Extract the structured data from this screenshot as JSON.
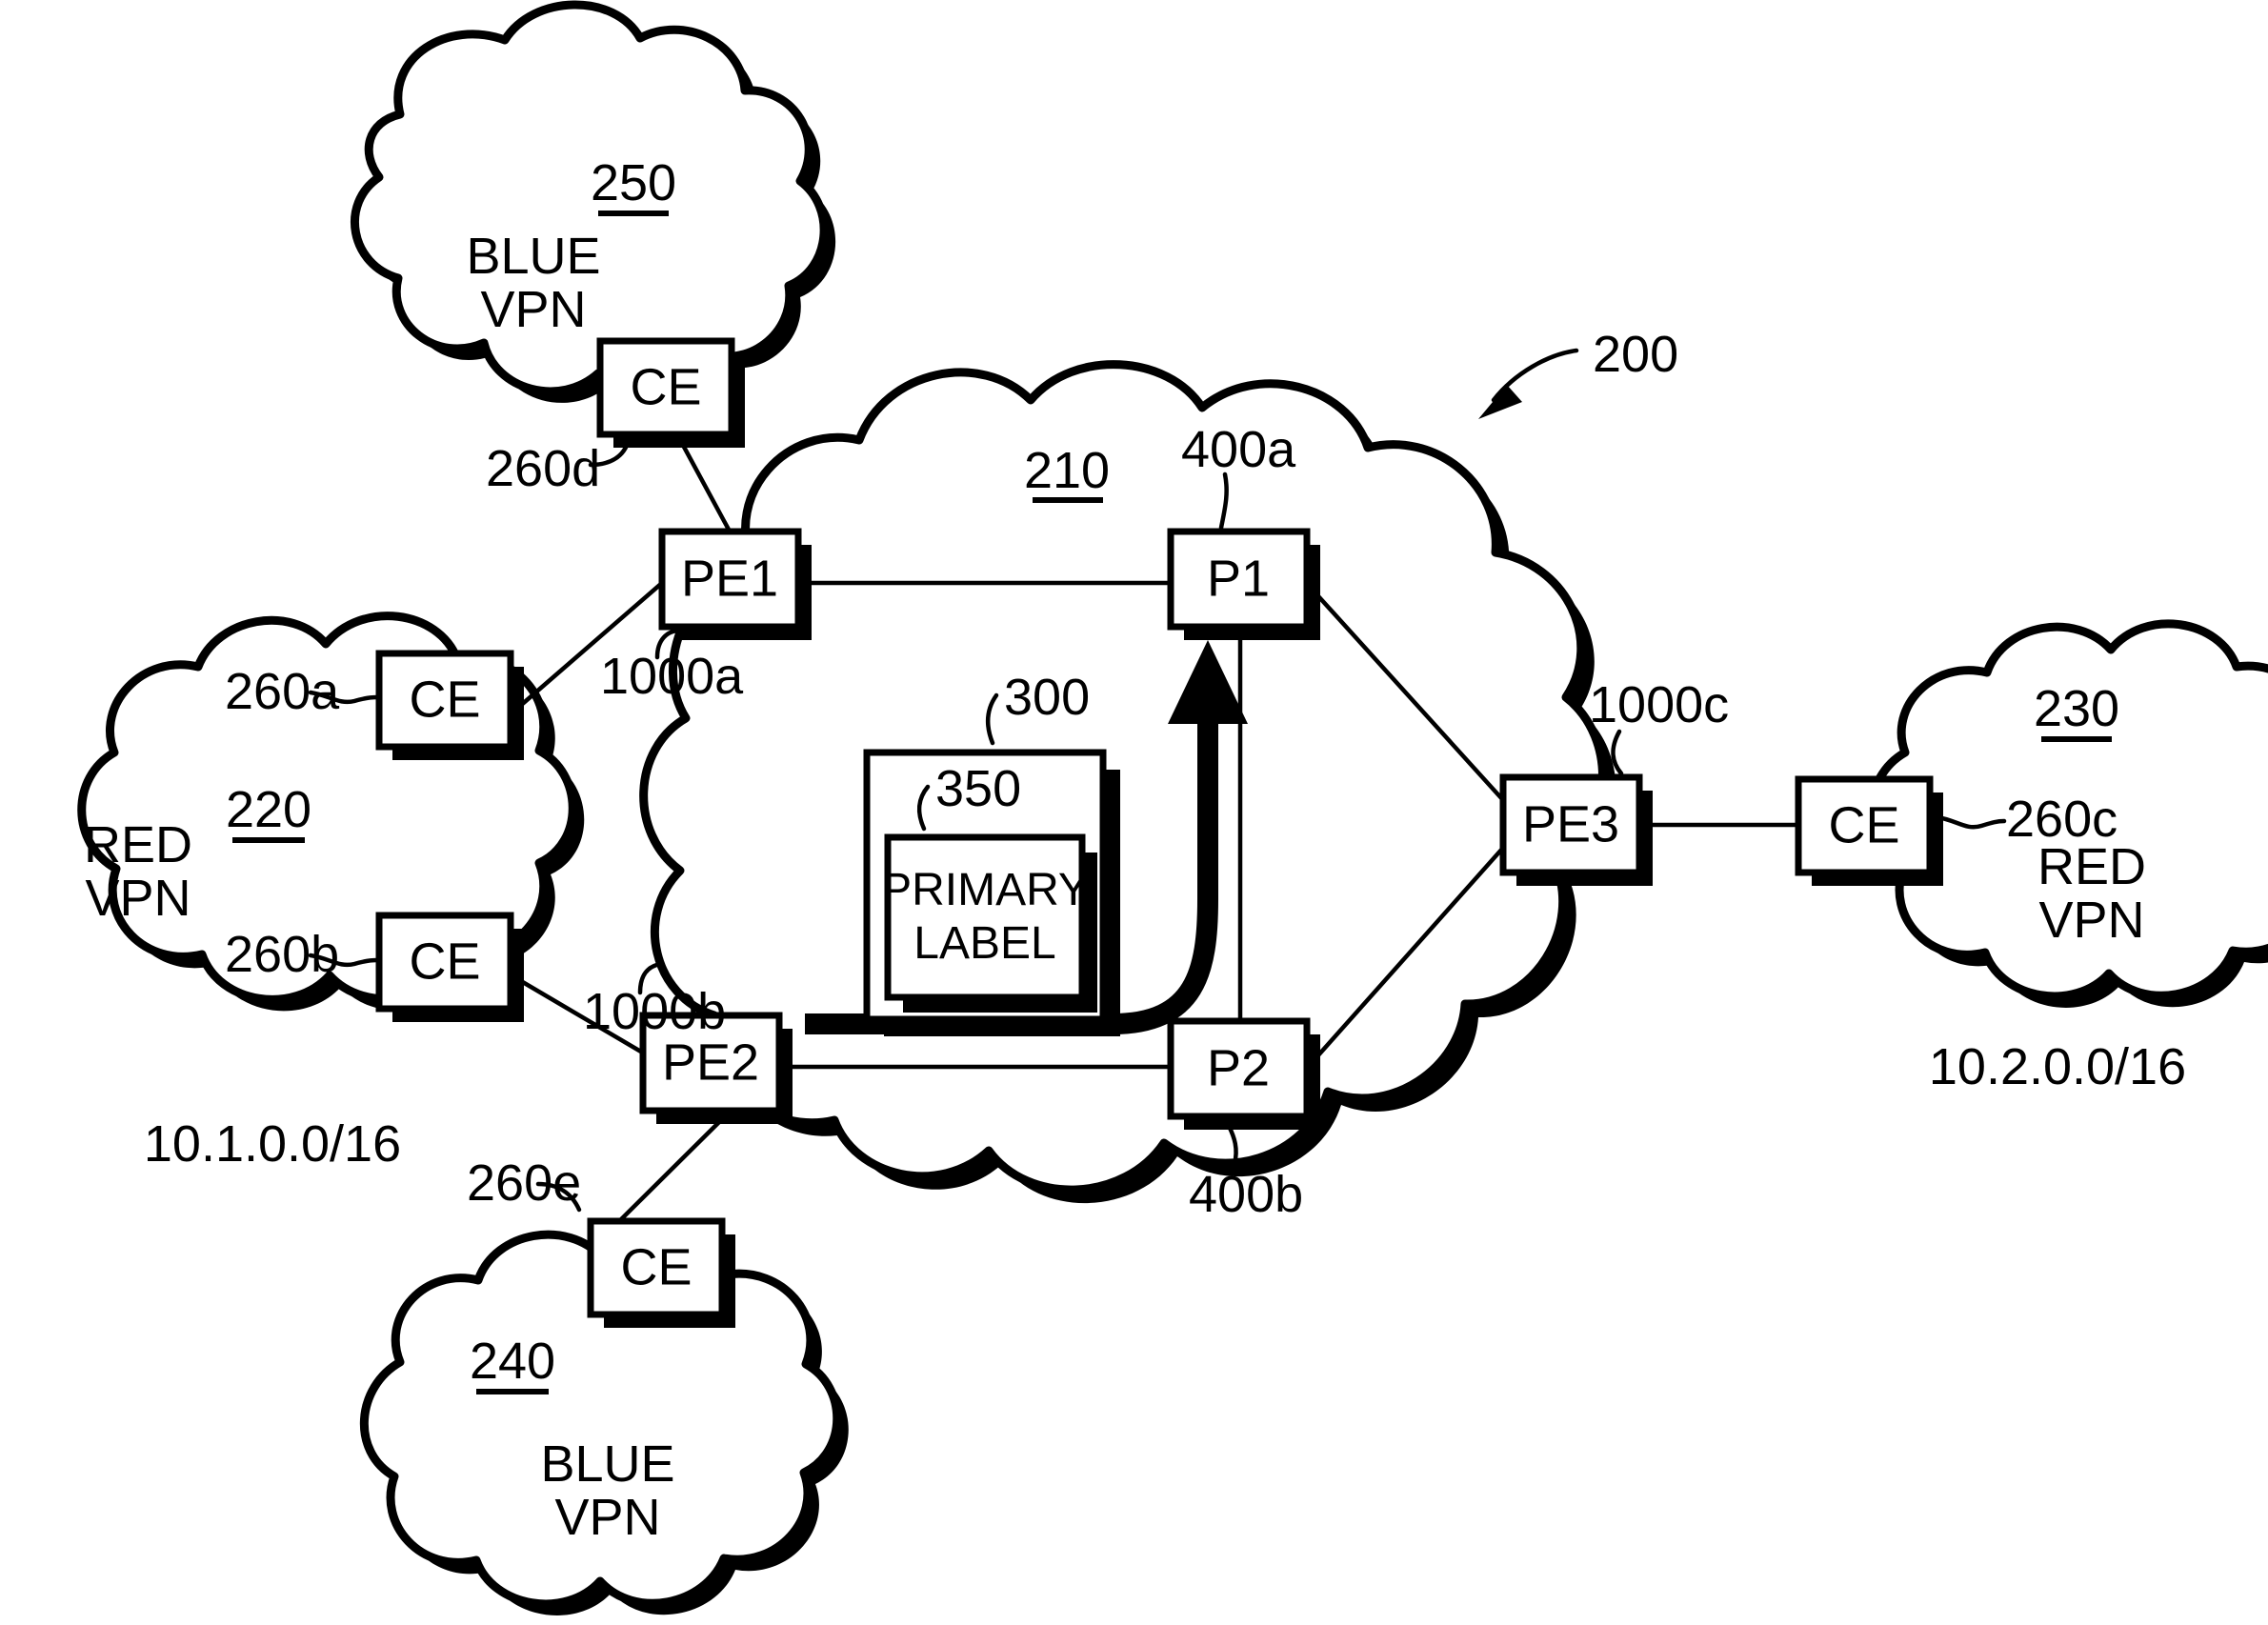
{
  "figure": {
    "kind": "patent-network-diagram",
    "overall_ref": "200",
    "core": {
      "ref": "210",
      "nodes": [
        {
          "id": "pe1",
          "label": "PE1",
          "ref": "1000a"
        },
        {
          "id": "pe2",
          "label": "PE2",
          "ref": "1000b"
        },
        {
          "id": "pe3",
          "label": "PE3",
          "ref": "1000c"
        },
        {
          "id": "p1",
          "label": "P1",
          "ref": "400a"
        },
        {
          "id": "p2",
          "label": "P2",
          "ref": "400b"
        }
      ]
    },
    "packet": {
      "outer_ref": "300",
      "inner_ref": "350",
      "inner_line1": "PRIMARY",
      "inner_line2": "LABEL"
    },
    "clouds": [
      {
        "id": "blue-top",
        "ref": "250",
        "line1": "BLUE",
        "line2": "VPN",
        "subnet": ""
      },
      {
        "id": "red-left",
        "ref": "220",
        "line1": "RED",
        "line2": "VPN",
        "subnet": "10.1.0.0/16"
      },
      {
        "id": "red-right",
        "ref": "230",
        "line1": "RED",
        "line2": "VPN",
        "subnet": "10.2.0.0/16"
      },
      {
        "id": "blue-bottom",
        "ref": "240",
        "line1": "BLUE",
        "line2": "VPN",
        "subnet": ""
      }
    ],
    "ce_nodes": [
      {
        "id": "ce-d",
        "label": "CE",
        "ref": "260d"
      },
      {
        "id": "ce-a",
        "label": "CE",
        "ref": "260a"
      },
      {
        "id": "ce-b",
        "label": "CE",
        "ref": "260b"
      },
      {
        "id": "ce-c",
        "label": "CE",
        "ref": "260c"
      },
      {
        "id": "ce-e",
        "label": "CE",
        "ref": "260e"
      }
    ],
    "colors": {
      "ink": "#000000",
      "paper": "#ffffff"
    }
  }
}
